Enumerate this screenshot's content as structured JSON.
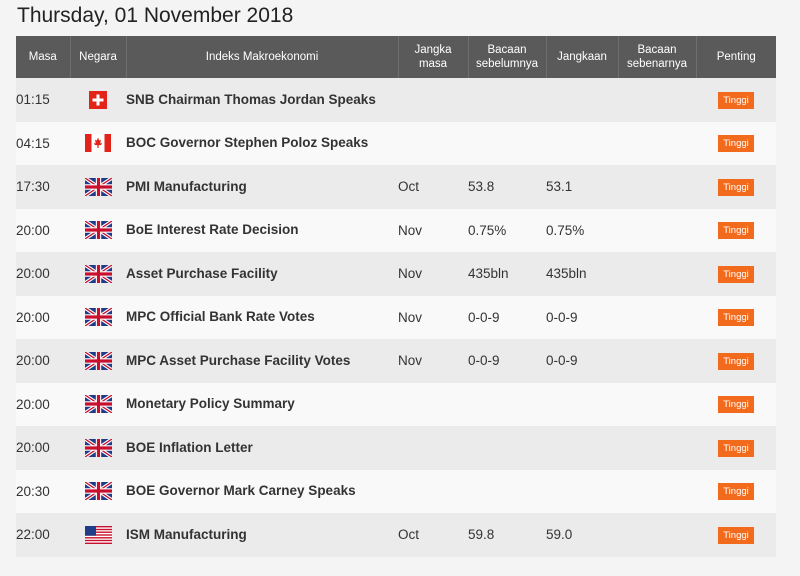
{
  "date": "Thursday, 01 November 2018",
  "headers": {
    "time": "Masa",
    "country": "Negara",
    "event": "Indeks Makroekonomi",
    "period": "Jangka masa",
    "previous": "Bacaan sebelumnya",
    "forecast": "Jangkaan",
    "actual": "Bacaan sebenarnya",
    "importance": "Penting"
  },
  "rows": [
    {
      "time": "01:15",
      "flag": "switzerland-flag-icon",
      "event": "SNB Chairman Thomas Jordan Speaks",
      "period": "",
      "previous": "",
      "forecast": "",
      "actual": "",
      "importance": "Tinggi"
    },
    {
      "time": "04:15",
      "flag": "canada-flag-icon",
      "event": "BOC Governor Stephen Poloz Speaks",
      "period": "",
      "previous": "",
      "forecast": "",
      "actual": "",
      "importance": "Tinggi"
    },
    {
      "time": "17:30",
      "flag": "uk-flag-icon",
      "event": "PMI Manufacturing",
      "period": "Oct",
      "previous": "53.8",
      "forecast": "53.1",
      "actual": "",
      "importance": "Tinggi"
    },
    {
      "time": "20:00",
      "flag": "uk-flag-icon",
      "event": "BoE Interest Rate Decision",
      "period": "Nov",
      "previous": "0.75%",
      "forecast": "0.75%",
      "actual": "",
      "importance": "Tinggi"
    },
    {
      "time": "20:00",
      "flag": "uk-flag-icon",
      "event": "Asset Purchase Facility",
      "period": "Nov",
      "previous": "435bln",
      "forecast": "435bln",
      "actual": "",
      "importance": "Tinggi"
    },
    {
      "time": "20:00",
      "flag": "uk-flag-icon",
      "event": "MPC Official Bank Rate Votes",
      "period": "Nov",
      "previous": "0-0-9",
      "forecast": "0-0-9",
      "actual": "",
      "importance": "Tinggi"
    },
    {
      "time": "20:00",
      "flag": "uk-flag-icon",
      "event": "MPC Asset Purchase Facility Votes",
      "period": "Nov",
      "previous": "0-0-9",
      "forecast": "0-0-9",
      "actual": "",
      "importance": "Tinggi"
    },
    {
      "time": "20:00",
      "flag": "uk-flag-icon",
      "event": "Monetary Policy Summary",
      "period": "",
      "previous": "",
      "forecast": "",
      "actual": "",
      "importance": "Tinggi"
    },
    {
      "time": "20:00",
      "flag": "uk-flag-icon",
      "event": "BOE Inflation Letter",
      "period": "",
      "previous": "",
      "forecast": "",
      "actual": "",
      "importance": "Tinggi"
    },
    {
      "time": "20:30",
      "flag": "uk-flag-icon",
      "event": "BOE Governor Mark Carney Speaks",
      "period": "",
      "previous": "",
      "forecast": "",
      "actual": "",
      "importance": "Tinggi"
    },
    {
      "time": "22:00",
      "flag": "us-flag-icon",
      "event": "ISM Manufacturing",
      "period": "Oct",
      "previous": "59.8",
      "forecast": "59.0",
      "actual": "",
      "importance": "Tinggi"
    }
  ],
  "colors": {
    "header_bg": "#5a5a5a",
    "row_odd": "#ebebeb",
    "row_even": "#f9f9f9",
    "badge": "#f26a1b"
  }
}
